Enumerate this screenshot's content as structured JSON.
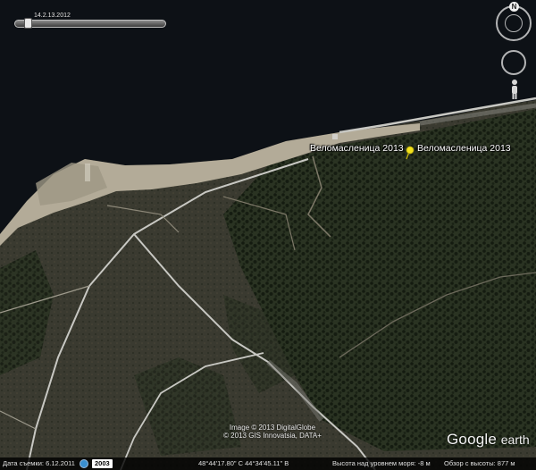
{
  "time_slider": {
    "label": "14.2.13.2012"
  },
  "navigation": {
    "north_label": "N"
  },
  "placemarks": [
    {
      "label": "Веломасленица 2013"
    },
    {
      "label": "Веломасленица 2013"
    }
  ],
  "attribution": {
    "line1": "Image © 2013 DigitalGlobe",
    "line2": "© 2013 GIS Innovatsia, DATA+"
  },
  "brand": {
    "google": "Google",
    "earth": "earth"
  },
  "status_bar": {
    "imagery_date": "Дата съемки: 6.12.2011",
    "year": "2003",
    "coordinates": "48°44'17.80\" С   44°34'45.11\" В",
    "elevation": "Высота над уровнем моря:    -8 м",
    "eye_altitude": "Обзор с высоты:    877 м"
  },
  "colors": {
    "water": "#0d1116",
    "shore": "#b3ab98",
    "vegetation": "#1f2a1a",
    "road": "#c8c8c3",
    "pin": "#f2e21c"
  },
  "icons": [
    "compass-icon",
    "north-button",
    "look-ring-icon",
    "pegman-icon",
    "placemark-pin-icon",
    "history-icon"
  ]
}
